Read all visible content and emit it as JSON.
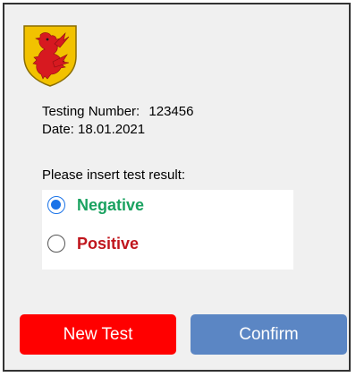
{
  "crest": {
    "icon": "heraldic-lion-shield",
    "field_color": "#f2c200",
    "charge_color": "#d71920"
  },
  "info": {
    "testing_number_label": "Testing Number:",
    "testing_number_value": "123456",
    "date_label": "Date:",
    "date_value": "18.01.2021"
  },
  "prompt": "Please insert test result:",
  "options": [
    {
      "label": "Negative",
      "checked": true,
      "color": "#1aa260"
    },
    {
      "label": "Positive",
      "checked": false,
      "color": "#c0161d"
    }
  ],
  "buttons": {
    "new_test": {
      "label": "New Test",
      "color": "#ff0000"
    },
    "confirm": {
      "label": "Confirm",
      "color": "#5b86c4"
    }
  }
}
